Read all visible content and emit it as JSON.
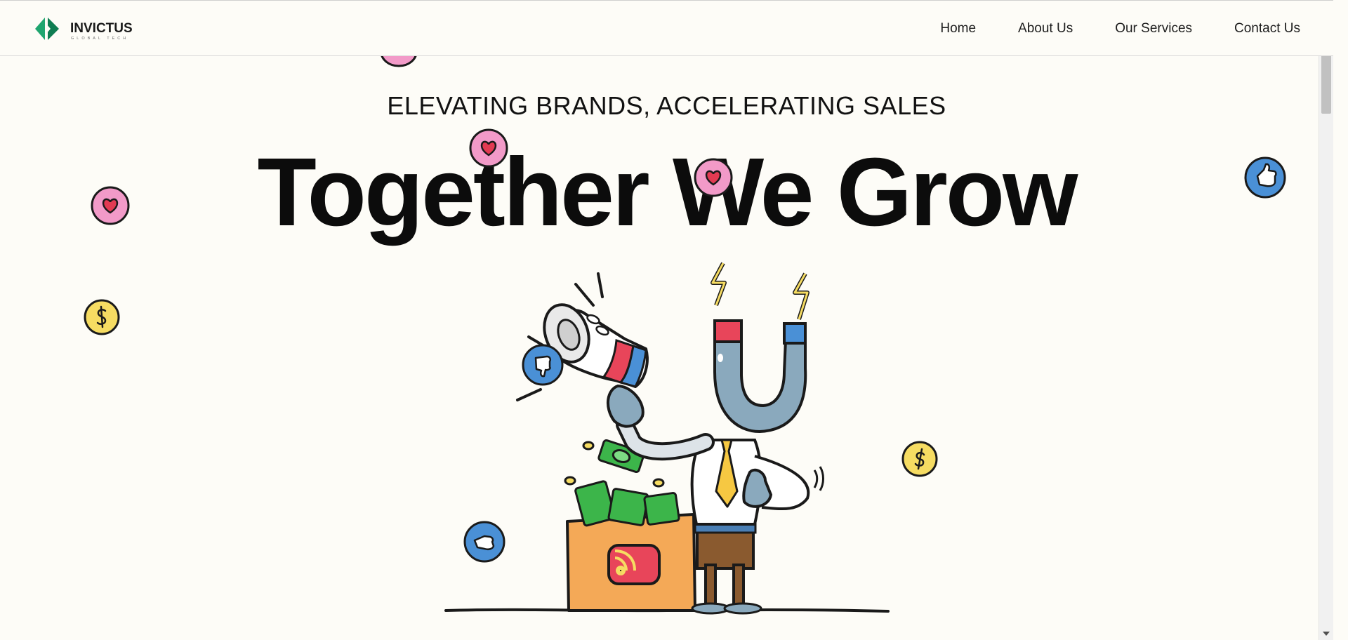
{
  "brand": {
    "name": "INVICTUS",
    "tagline": "GLOBAL TECH",
    "logo_color": "#1fa56f"
  },
  "nav": {
    "items": [
      "Home",
      "About Us",
      "Our Services",
      "Contact Us"
    ]
  },
  "hero": {
    "subtitle": "ELEVATING BRANDS, ACCELERATING SALES",
    "title": "Together We Grow"
  },
  "colors": {
    "background": "#fdfcf7",
    "heart_bubble": "#f29ac8",
    "thumb_bubble": "#4a90d6",
    "dollar_bubble": "#f6dc62",
    "megaphone_red": "#e8455a",
    "magnet_body": "#8aa9bd",
    "box_orange": "#f4a957",
    "money_green": "#3cb54a"
  },
  "decorations": [
    "heart-bubble-icon",
    "thumbs-up-bubble-icon",
    "thumbs-down-bubble-icon",
    "dollar-bubble-icon"
  ]
}
